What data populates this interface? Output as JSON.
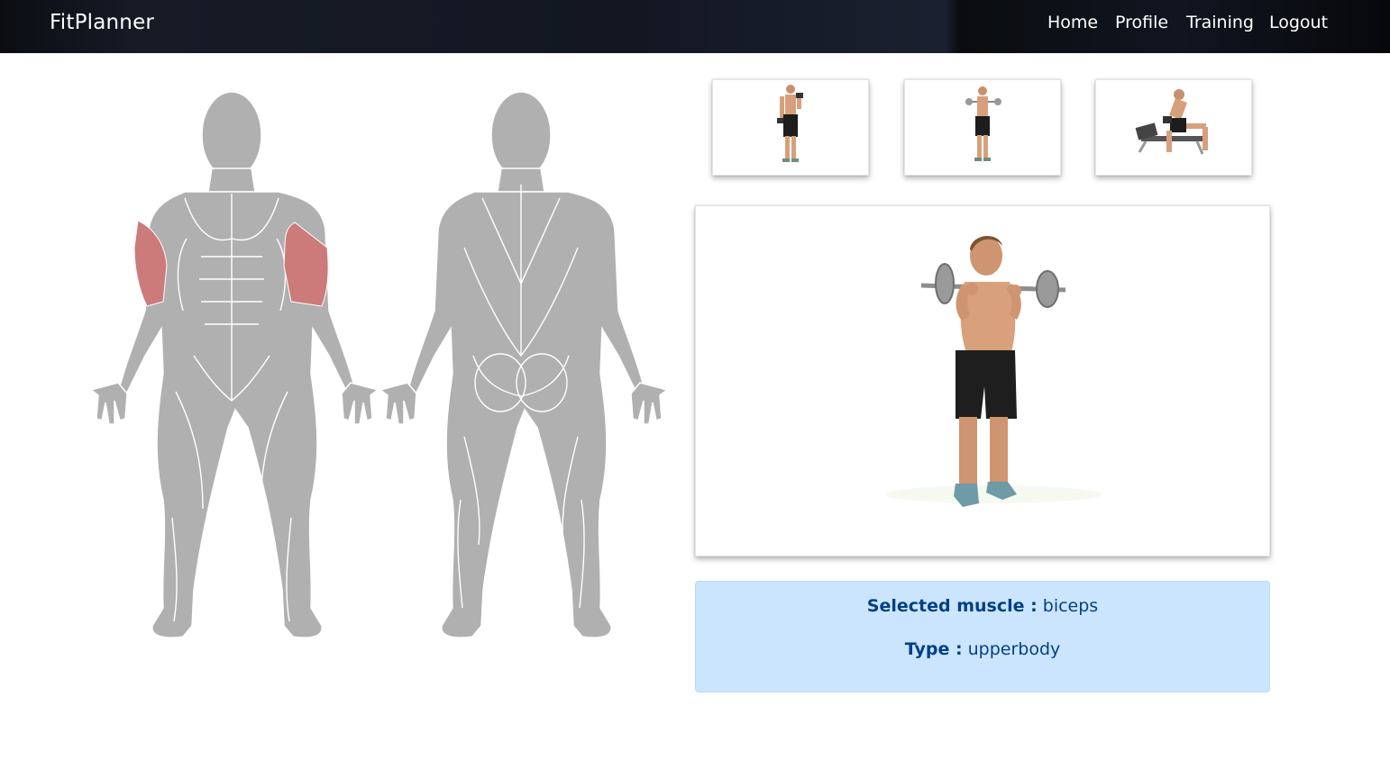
{
  "navbar": {
    "brand": "FitPlanner",
    "links": [
      {
        "label": "Home"
      },
      {
        "label": "Profile"
      },
      {
        "label": "Training"
      },
      {
        "label": "Logout"
      }
    ]
  },
  "muscle_map": {
    "highlighted_muscle": "biceps",
    "highlight_color": "#cc7a7a",
    "body_color": "#b0b0b0"
  },
  "exercise_thumbnails": [
    {
      "name": "dumbbell-curl"
    },
    {
      "name": "barbell-curl"
    },
    {
      "name": "concentration-curl"
    }
  ],
  "info": {
    "muscle_label": "Selected muscle :",
    "muscle_value": "biceps",
    "type_label": "Type :",
    "type_value": "upperbody"
  },
  "colors": {
    "info_bg": "#cce5ff",
    "info_text": "#004085",
    "nav_bg": "#111520"
  }
}
